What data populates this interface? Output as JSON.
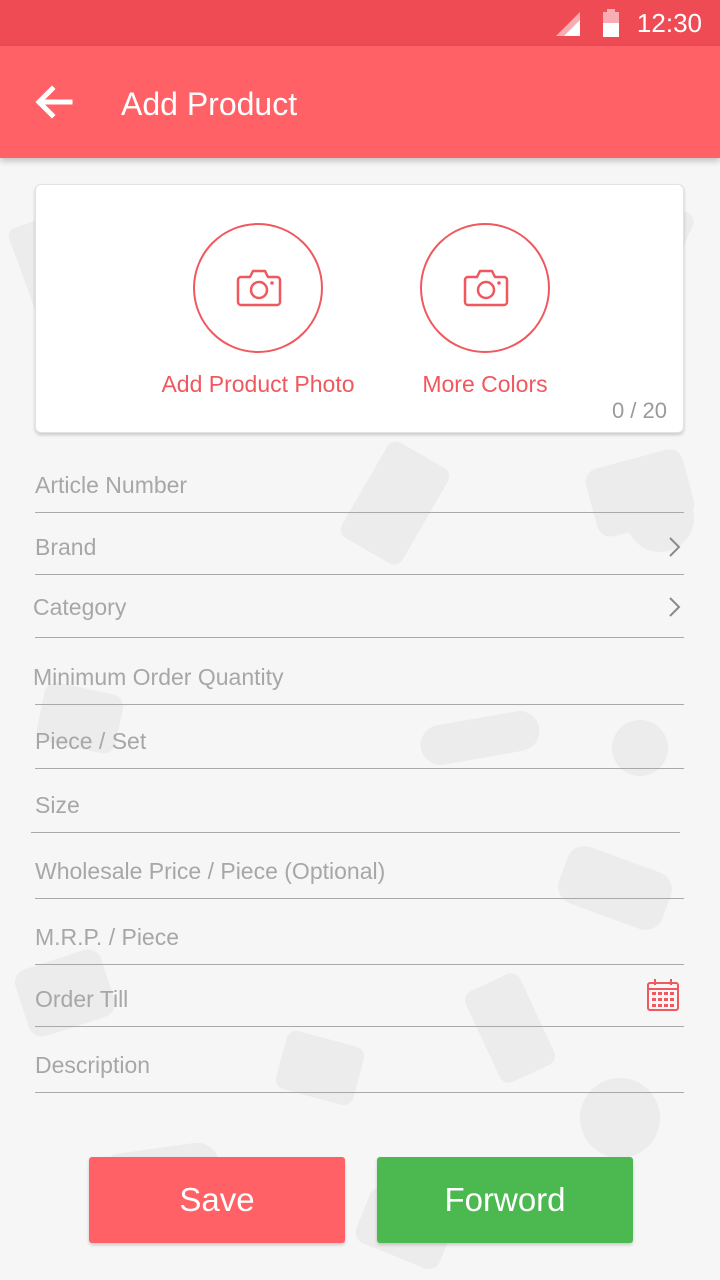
{
  "status_bar": {
    "time": "12:30"
  },
  "app_bar": {
    "title": "Add Product"
  },
  "photo_card": {
    "add_photo_label": "Add Product Photo",
    "more_colors_label": "More Colors",
    "count": "0 / 20"
  },
  "form": {
    "fields": [
      {
        "label": "Article Number"
      },
      {
        "label": "Brand"
      },
      {
        "label": "Category"
      },
      {
        "label": "Minimum Order Quantity"
      },
      {
        "label": "Piece / Set"
      },
      {
        "label": "Size"
      },
      {
        "label": "Wholesale Price / Piece (Optional)"
      },
      {
        "label": "M.R.P. / Piece"
      },
      {
        "label": "Order Till"
      },
      {
        "label": "Description"
      }
    ]
  },
  "buttons": {
    "save": "Save",
    "forward": "Forword"
  },
  "colors": {
    "status_bar": "#ee4b55",
    "app_bar": "#ff6166",
    "accent": "#f0585e",
    "forward": "#4cb950"
  }
}
